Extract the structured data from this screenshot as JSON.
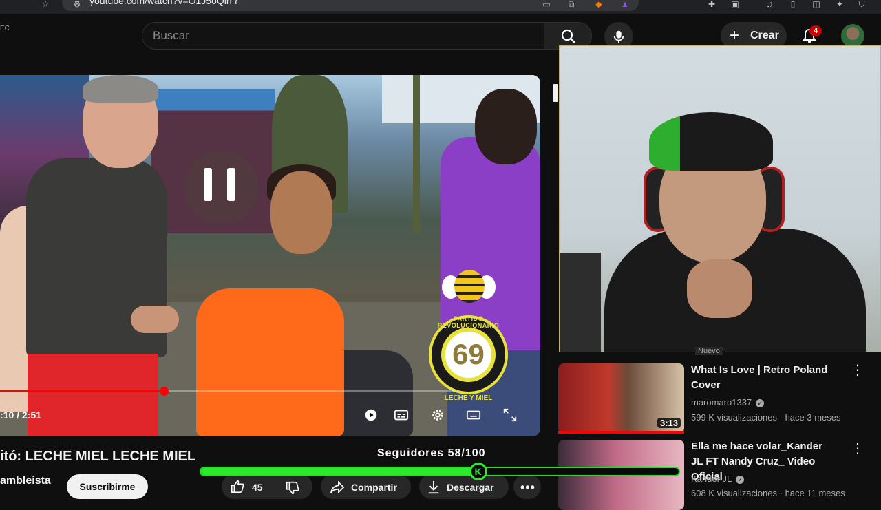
{
  "browser": {
    "url": "youtube.com/watch?v=O1J5oQirrY"
  },
  "header": {
    "badge": "EC",
    "search_placeholder": "Buscar",
    "create_label": "Crear",
    "notifications_count": "4"
  },
  "player": {
    "time": ":10 / 2:51",
    "progress_fraction": 0.36
  },
  "overlay": {
    "logo_number": "69",
    "logo_top_text": "PARTIDO REVOLUCIONARIO",
    "logo_bottom_text": "LECHE Y MIEL",
    "followers_label": "Seguidores 58/100",
    "followers_fraction": 0.58,
    "knob_letter": "K"
  },
  "video": {
    "title": "itó: LECHE MIEL LECHE MIEL",
    "channel": "ambleista",
    "subscribe_label": "Suscribirme",
    "likes": "45",
    "share_label": "Compartir",
    "download_label": "Descargar"
  },
  "recommendations": [
    {
      "badge": "Nuevo",
      "title": "What Is Love | Retro Poland Cover",
      "channel": "maromaro1337",
      "meta": "599 K visualizaciones · hace 3 meses",
      "duration": "3:13"
    },
    {
      "title": "Ella me hace volar_Kander JL FT Nandy Cruz_ Video Oficial",
      "channel": "Kander JL",
      "meta": "608 K visualizaciones · hace 11 meses"
    }
  ],
  "colors": {
    "accent_red": "#ff0000",
    "followers_green": "#2ee82e",
    "logo_yellow": "#e8e23a"
  }
}
